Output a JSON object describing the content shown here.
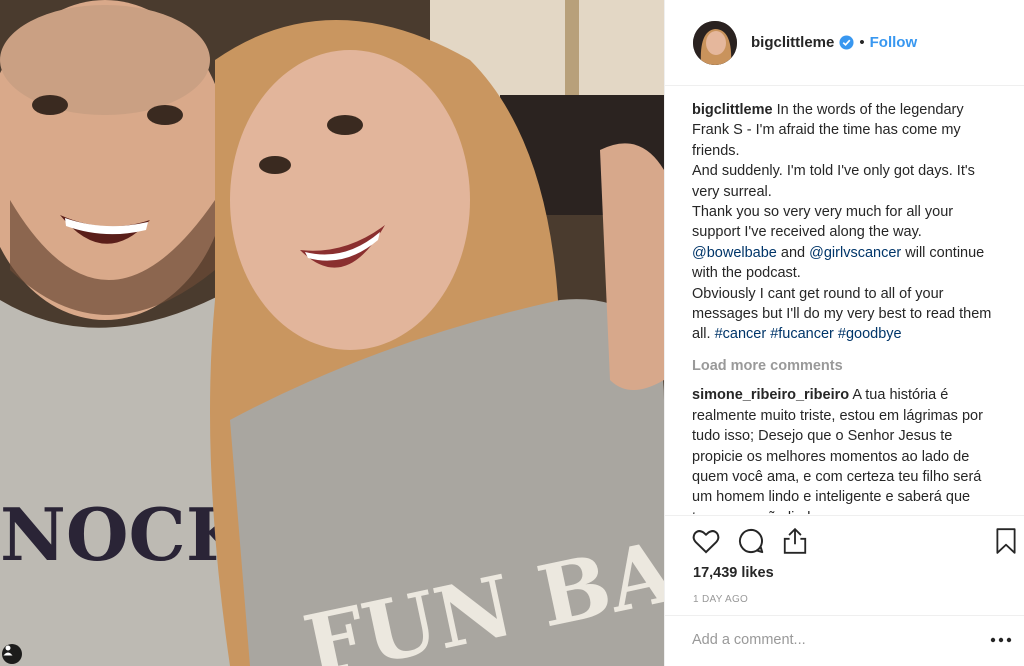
{
  "photo": {
    "shirt_left_text": "NOCK R",
    "shirt_right_text": "FUN BAG"
  },
  "header": {
    "username": "bigclittleme",
    "separator": "•",
    "follow_label": "Follow"
  },
  "caption": {
    "username": "bigclittleme",
    "line1": "In the words of the legendary Frank S - I'm afraid the time has come my friends.",
    "line2": "And suddenly. I'm told I've only got days. It's very surreal.",
    "line3": "Thank you so very very much for all your support I've received along the way.",
    "mention1": "@bowelbabe",
    "mention_joiner": "and",
    "mention2": "@girlvscancer",
    "line4_tail": "will continue with the podcast.",
    "line5": "Obviously I cant get round to all of your messages but I'll do my very best to read them all.",
    "hashtag1": "#cancer",
    "hashtag2": "#fucancer",
    "hashtag3": "#goodbye"
  },
  "load_more_label": "Load more comments",
  "comments": [
    {
      "username": "simone_ribeiro_ribeiro",
      "text": "A tua história é realmente muito triste, estou em lágrimas por tudo isso; Desejo que o Senhor Jesus te propicie os melhores momentos ao lado de quem você ama, e com certeza teu filho será um homem lindo e inteligente e saberá que teve uma mãe linda e"
    }
  ],
  "likes_label": "17,439 likes",
  "time_ago": "1 DAY AGO",
  "add_comment_placeholder": "Add a comment...",
  "icons": {
    "like": "heart-icon",
    "comment": "comment-bubble-icon",
    "share": "share-icon",
    "save": "bookmark-icon",
    "more": "more-options-icon",
    "verified": "verified-badge-icon",
    "user_tags": "user-tag-icon"
  },
  "colors": {
    "link_blue": "#3897f0",
    "hashtag_navy": "#003569",
    "muted_gray": "#999999",
    "text_dark": "#262626",
    "divider": "#efefef"
  }
}
